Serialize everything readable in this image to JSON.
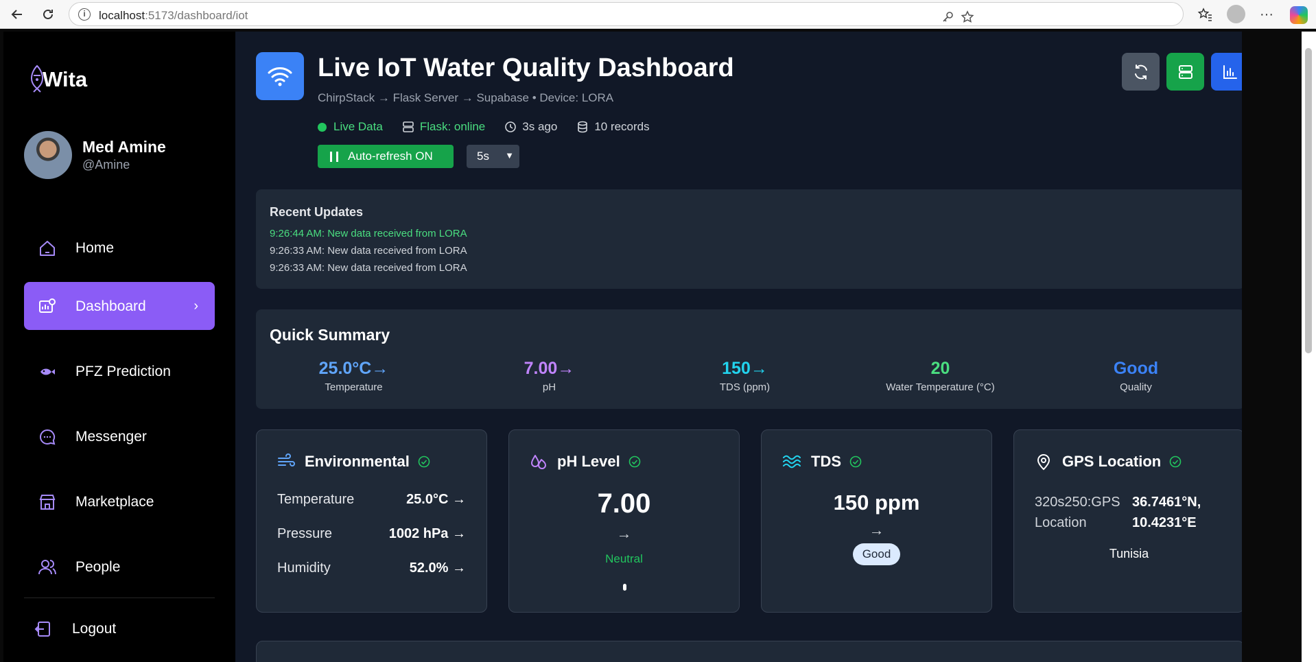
{
  "browser": {
    "url_host": "localhost",
    "url_path": ":5173/dashboard/iot"
  },
  "sidebar": {
    "brand": "Wita",
    "profile": {
      "name": "Med Amine",
      "handle": "@Amine"
    },
    "items": [
      {
        "label": "Home",
        "icon": "home-icon"
      },
      {
        "label": "Dashboard",
        "icon": "dashboard-icon",
        "active": true
      },
      {
        "label": "PFZ Prediction",
        "icon": "fish-icon"
      },
      {
        "label": "Messenger",
        "icon": "chat-icon"
      },
      {
        "label": "Marketplace",
        "icon": "store-icon"
      },
      {
        "label": "People",
        "icon": "people-icon"
      }
    ],
    "logout": "Logout"
  },
  "header": {
    "title": "Live IoT Water Quality Dashboard",
    "subtitle": "ChirpStack → Flask Server → Supabase • Device: LORA",
    "status": {
      "live": "Live Data",
      "flask": "Flask: online",
      "time": "3s ago",
      "records": "10 records"
    },
    "auto_refresh": "Auto-refresh ON",
    "interval": "5s"
  },
  "updates": {
    "title": "Recent Updates",
    "items": [
      "9:26:44 AM: New data received from LORA",
      "9:26:33 AM: New data received from LORA",
      "9:26:33 AM: New data received from LORA"
    ]
  },
  "summary": {
    "title": "Quick Summary",
    "items": [
      {
        "value": "25.0°C",
        "trend": "→",
        "label": "Temperature",
        "color": "#60a5fa"
      },
      {
        "value": "7.00",
        "trend": "→",
        "label": "pH",
        "color": "#c084fc"
      },
      {
        "value": "150",
        "trend": "→",
        "label": "TDS (ppm)",
        "color": "#22d3ee"
      },
      {
        "value": "20",
        "trend": "",
        "label": "Water Temperature (°C)",
        "color": "#4ade80"
      },
      {
        "value": "Good",
        "trend": "",
        "label": "Quality",
        "color": "#3b82f6"
      }
    ]
  },
  "cards": {
    "environmental": {
      "title": "Environmental",
      "rows": [
        {
          "key": "Temperature",
          "value": "25.0°C →"
        },
        {
          "key": "Pressure",
          "value": "1002 hPa →"
        },
        {
          "key": "Humidity",
          "value": "52.0% →"
        }
      ]
    },
    "ph": {
      "title": "pH Level",
      "value": "7.00",
      "trend": "→",
      "status": "Neutral"
    },
    "tds": {
      "title": "TDS",
      "value": "150 ppm",
      "trend": "→",
      "badge": "Good"
    },
    "gps": {
      "title": "GPS Location",
      "label_line1": "320s250:GPS",
      "label_line2": "Location",
      "lat": "36.7461°N,",
      "lon": "10.4231°E",
      "country": "Tunisia"
    }
  }
}
